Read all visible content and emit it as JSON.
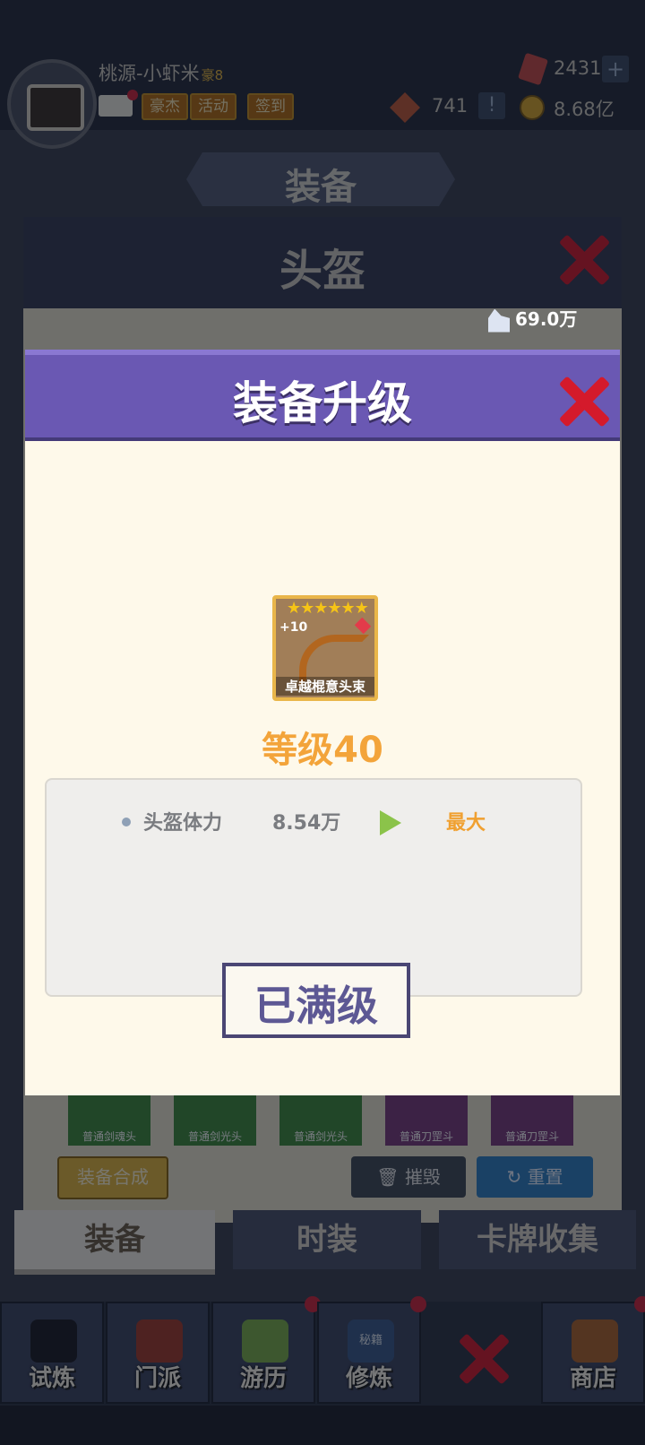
{
  "player": {
    "name": "桃源-小虾米",
    "vip": "豪8"
  },
  "top_tags": {
    "hero": "豪杰",
    "event": "活动",
    "signin": "签到"
  },
  "currencies": {
    "gems": "2431",
    "tokens": "741",
    "gold": "8.68亿"
  },
  "screen": {
    "title": "装备"
  },
  "panel": {
    "title": "头盔",
    "power": "69.0万"
  },
  "slots": [
    "普通剑魂头",
    "普通剑光头",
    "普通剑光头",
    "普通刀罡斗",
    "普通刀罡斗"
  ],
  "panel_buttons": {
    "synthesize": "装备合成",
    "destroy": "摧毁",
    "reset": "重置"
  },
  "bottom_tabs": [
    "装备",
    "时装",
    "卡牌收集"
  ],
  "nav": [
    "试炼",
    "门派",
    "游历",
    "修炼",
    "商店"
  ],
  "nav_icon_text": "秘籍",
  "modal": {
    "title": "装备升级",
    "item": {
      "name": "卓越棍意头束",
      "enhance": "+10",
      "stars": "★★★★★★"
    },
    "level": "等级40",
    "stats": [
      {
        "name": "头盔体力",
        "value": "8.54万",
        "next": "最大"
      }
    ],
    "button": "已满级"
  },
  "colors": {
    "modal_header": "#6a58b3",
    "level": "#f3a43a",
    "close": "#d41a2b"
  }
}
